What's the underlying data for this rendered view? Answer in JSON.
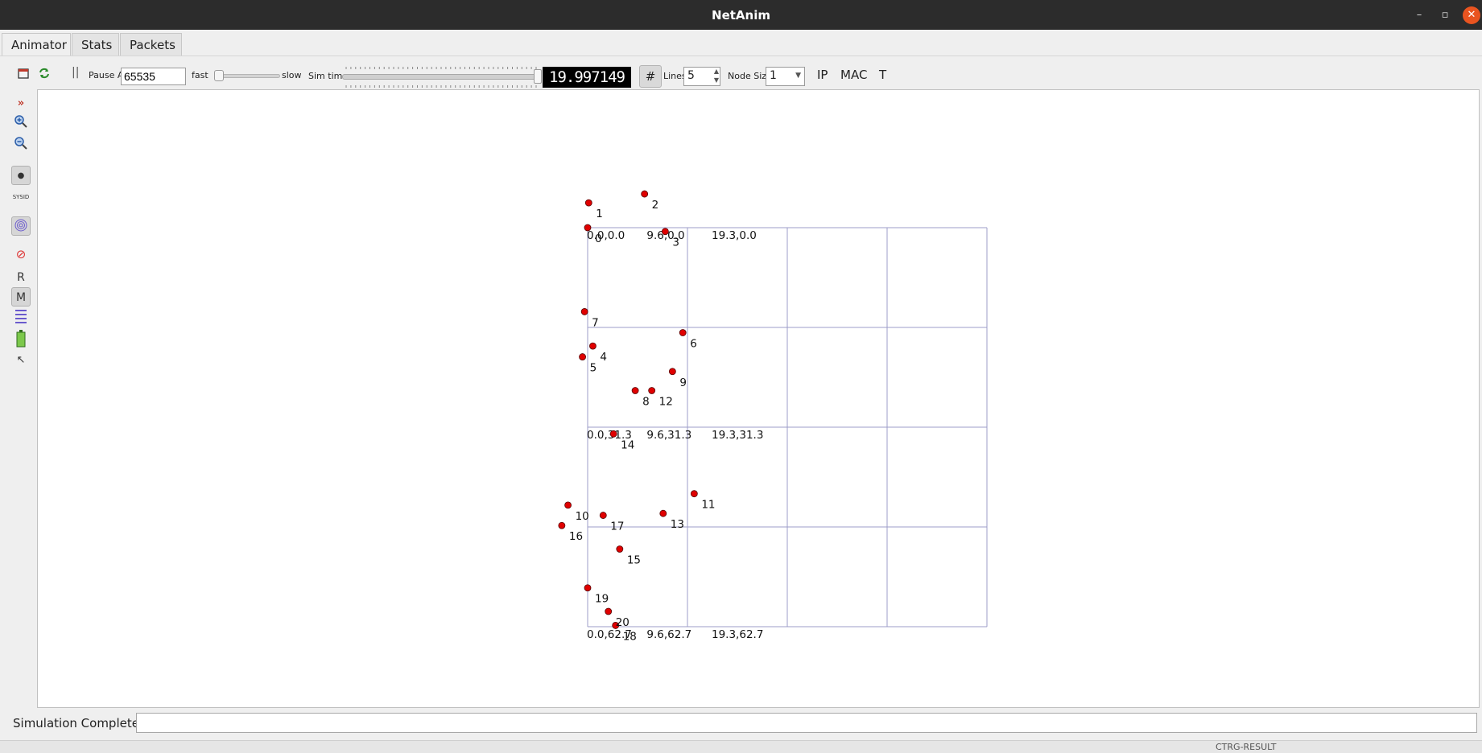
{
  "window": {
    "title": "NetAnim",
    "minimize_glyph": "–",
    "maximize_glyph": "▫",
    "close_glyph": "✕"
  },
  "tabs": [
    {
      "label": "Animator"
    },
    {
      "label": "Stats"
    },
    {
      "label": "Packets"
    }
  ],
  "toolbar": {
    "pause_at_label": "Pause At",
    "pause_at_value": "65535",
    "fast_label": "fast",
    "slow_label": "slow",
    "sim_time_label": "Sim time",
    "sim_time_value": "19.997149",
    "sim_progress": 1.0,
    "grid_glyph": "#",
    "lines_label": "Lines",
    "lines_value": "5",
    "node_size_label": "Node Size",
    "node_size_value": "1",
    "ip_label": "IP",
    "mac_label": "MAC",
    "t_label": "T"
  },
  "sidebar": {
    "r_label": "R",
    "m_label": "M",
    "sysid_label": "SYSID"
  },
  "grid": {
    "coord_labels": [
      "0.0,0.0",
      "9.6,0.0",
      "19.3,0.0",
      "0.0,31.3",
      "9.6,31.3",
      "19.3,31.3",
      "0.0,62.7",
      "9.6,62.7",
      "19.3,62.7"
    ]
  },
  "nodes": [
    {
      "id": "0",
      "x": 0.0,
      "y": 0.0
    },
    {
      "id": "1",
      "x": 0.1,
      "y": -3.9
    },
    {
      "id": "2",
      "x": 5.5,
      "y": -5.3
    },
    {
      "id": "3",
      "x": 7.5,
      "y": 0.6
    },
    {
      "id": "4",
      "x": 0.5,
      "y": 18.6
    },
    {
      "id": "5",
      "x": -0.5,
      "y": 20.3
    },
    {
      "id": "6",
      "x": 9.2,
      "y": 16.5
    },
    {
      "id": "7",
      "x": -0.3,
      "y": 13.2
    },
    {
      "id": "8",
      "x": 4.6,
      "y": 25.6
    },
    {
      "id": "9",
      "x": 8.2,
      "y": 22.6
    },
    {
      "id": "10",
      "x": -1.9,
      "y": 43.6
    },
    {
      "id": "11",
      "x": 10.3,
      "y": 41.8
    },
    {
      "id": "12",
      "x": 6.2,
      "y": 25.6
    },
    {
      "id": "13",
      "x": 7.3,
      "y": 44.9
    },
    {
      "id": "14",
      "x": 2.5,
      "y": 32.4
    },
    {
      "id": "15",
      "x": 3.1,
      "y": 50.5
    },
    {
      "id": "16",
      "x": -2.5,
      "y": 46.8
    },
    {
      "id": "17",
      "x": 1.5,
      "y": 45.2
    },
    {
      "id": "18",
      "x": 2.7,
      "y": 62.5
    },
    {
      "id": "19",
      "x": 0.0,
      "y": 56.6
    },
    {
      "id": "20",
      "x": 2.0,
      "y": 60.3
    }
  ],
  "status": {
    "text": "Simulation Completed",
    "message": ""
  },
  "taskbar": {
    "tray_text": "CTRG-RESULT"
  },
  "colors": {
    "node": "#e00000",
    "grid_line": "#9c9cc8",
    "lcd_bg": "#000000",
    "close_btn": "#e95420"
  }
}
